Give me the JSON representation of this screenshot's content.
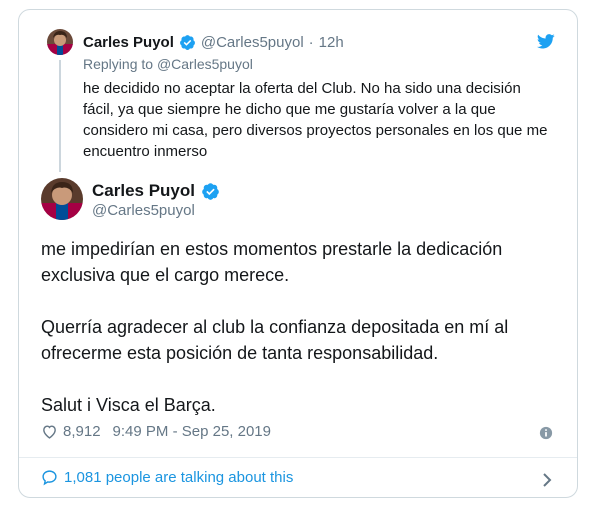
{
  "parent_tweet": {
    "name": "Carles Puyol",
    "handle": "@Carles5puyol",
    "separator": "·",
    "time": "12h",
    "replying_prefix": "Replying to",
    "replying_handle": "@Carles5puyol",
    "text": "he decidido no aceptar la oferta del Club. No ha sido una decisión fácil, ya que siempre he dicho que me gustaría volver a la que considero mi casa, pero diversos proyectos personales en los que me encuentro inmerso"
  },
  "main_tweet": {
    "name": "Carles Puyol",
    "handle": "@Carles5puyol",
    "paragraphs": [
      "me impedirían en estos momentos prestarle la dedicación exclusiva que el cargo merece.",
      "Querría agradecer al club la confianza depositada en mí al ofrecerme esta posición de tanta responsabilidad.",
      "Salut i Visca el Barça."
    ],
    "likes": "8,912",
    "timestamp": "9:49 PM - Sep 25, 2019"
  },
  "footer": {
    "talking_text": "1,081 people are talking about this"
  },
  "icons": {
    "verified": "verified-badge-icon",
    "twitter": "twitter-bird-icon",
    "heart": "heart-icon",
    "info": "info-icon",
    "comment": "comment-bubble-icon",
    "chevron": "chevron-right-icon"
  },
  "colors": {
    "twitter_blue": "#1da1f2",
    "link_blue": "#1b95e0",
    "secondary_text": "#657786",
    "primary_text": "#14171a",
    "border": "#cfd9de"
  }
}
